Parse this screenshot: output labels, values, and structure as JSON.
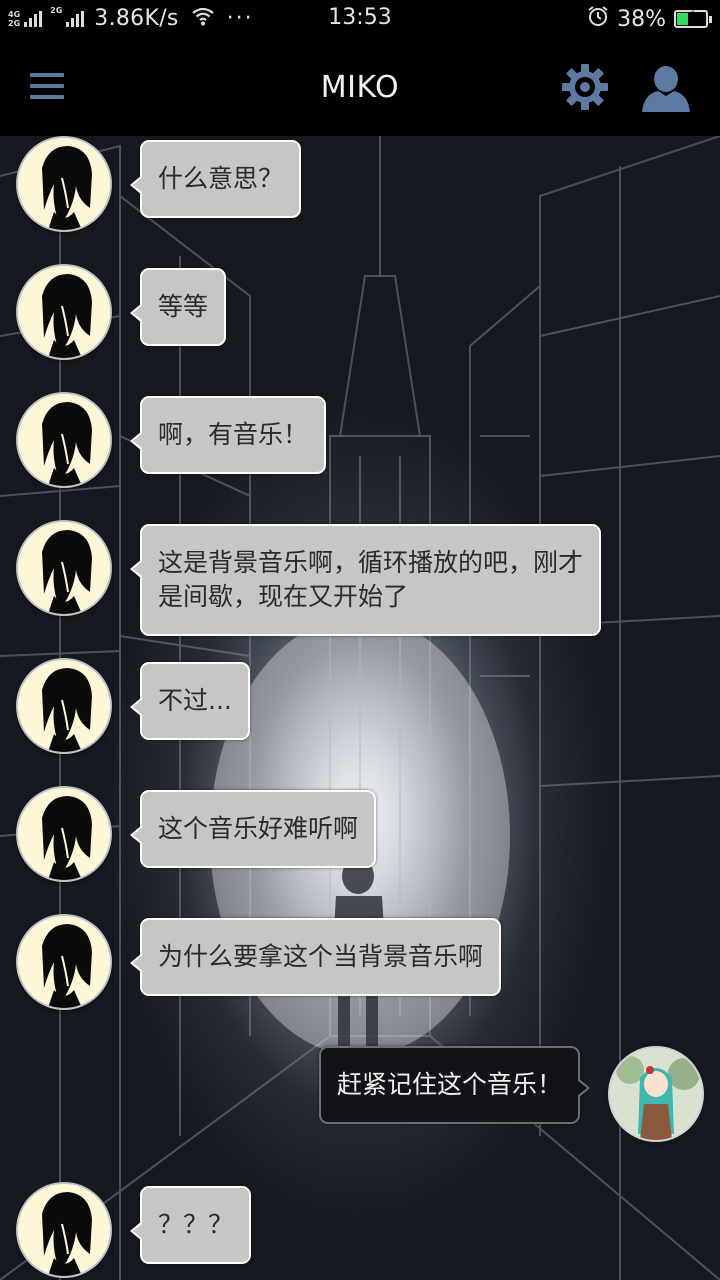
{
  "status_bar": {
    "net_top": "4G",
    "net_bottom": "2G",
    "net_mid": "2G",
    "speed": "3.86K/s",
    "dots": "···",
    "time": "13:53",
    "battery": "38%",
    "battery_level": 0.38,
    "battery_color": "#2ee05b"
  },
  "header": {
    "title": "MIKO",
    "menu_icon": "menu-icon",
    "gear_icon": "gear-icon",
    "user_icon": "user-icon",
    "accent": "#5e7aa3"
  },
  "messages": [
    {
      "side": "left",
      "text": "什么意思？"
    },
    {
      "side": "left",
      "text": "等等"
    },
    {
      "side": "left",
      "text": "啊，有音乐！"
    },
    {
      "side": "left",
      "text": "这是背景音乐啊，循环播放的吧，刚才\n是间歇，现在又开始了"
    },
    {
      "side": "left",
      "text": "不过..."
    },
    {
      "side": "left",
      "text": "这个音乐好难听啊"
    },
    {
      "side": "left",
      "text": "为什么要拿这个当背景音乐啊"
    },
    {
      "side": "right",
      "text": "赶紧记住这个音乐！"
    },
    {
      "side": "left",
      "text": "？？？"
    }
  ]
}
